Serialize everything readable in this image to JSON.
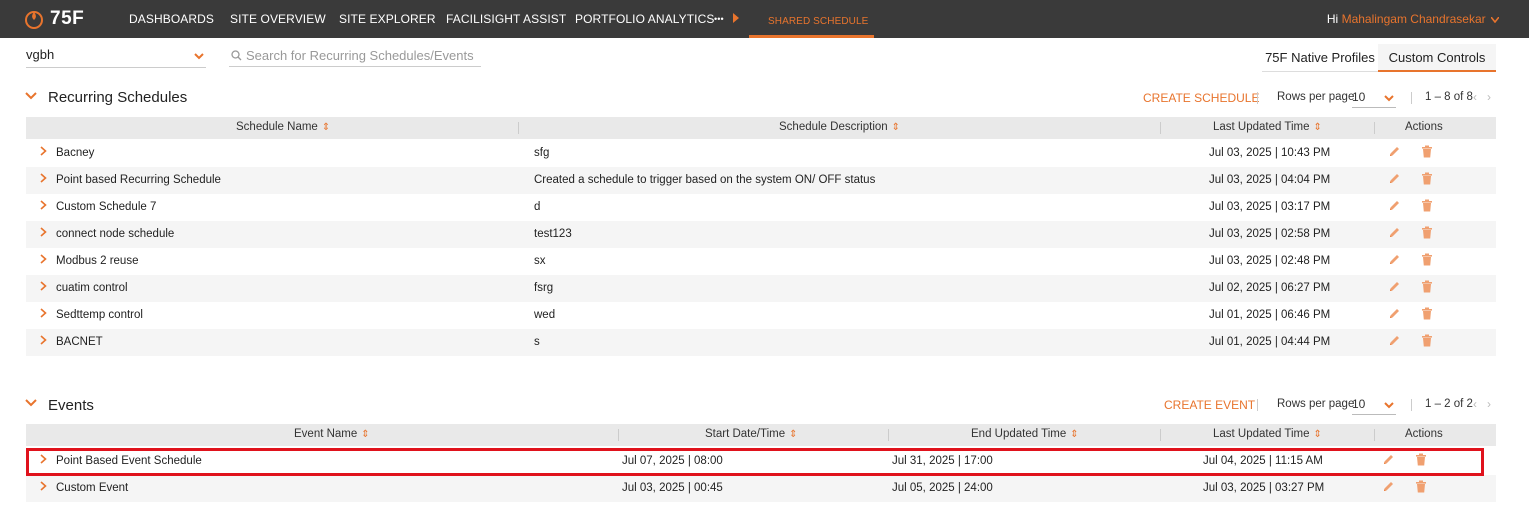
{
  "topbar": {
    "logo_text": "75F",
    "nav": [
      "DASHBOARDS",
      "SITE OVERVIEW",
      "SITE EXPLORER",
      "FACILISIGHT ASSIST",
      "PORTFOLIO ANALYTICS"
    ],
    "more": "•••",
    "active_tab": "SHARED SCHEDULE",
    "greeting": "Hi",
    "user_name": "Mahalingam Chandrasekar"
  },
  "filters": {
    "site": "vgbh",
    "search_placeholder": "Search for Recurring Schedules/Events"
  },
  "toggle": {
    "native": "75F Native Profiles",
    "custom": "Custom Controls"
  },
  "recurring": {
    "title": "Recurring Schedules",
    "create": "CREATE SCHEDULE",
    "rows_per_page_label": "Rows per page",
    "rows_per_page": "10",
    "range": "1 – 8 of 8",
    "columns": [
      "Schedule Name",
      "Schedule Description",
      "Last Updated Time",
      "Actions"
    ],
    "rows": [
      {
        "name": "Bacney",
        "desc": "sfg",
        "updated": "Jul 03, 2025 | 10:43 PM"
      },
      {
        "name": "Point based Recurring Schedule",
        "desc": "Created a schedule to trigger based on the system ON/ OFF status",
        "updated": "Jul 03, 2025 | 04:04 PM"
      },
      {
        "name": "Custom Schedule 7",
        "desc": "d",
        "updated": "Jul 03, 2025 | 03:17 PM"
      },
      {
        "name": "connect node schedule",
        "desc": "test123",
        "updated": "Jul 03, 2025 | 02:58 PM"
      },
      {
        "name": "Modbus 2 reuse",
        "desc": "sx",
        "updated": "Jul 03, 2025 | 02:48 PM"
      },
      {
        "name": "cuatim control",
        "desc": "fsrg",
        "updated": "Jul 02, 2025 | 06:27 PM"
      },
      {
        "name": "Sedttemp control",
        "desc": "wed",
        "updated": "Jul 01, 2025 | 06:46 PM"
      },
      {
        "name": "BACNET",
        "desc": "s",
        "updated": "Jul 01, 2025 | 04:44 PM"
      }
    ]
  },
  "events": {
    "title": "Events",
    "create": "CREATE EVENT",
    "rows_per_page_label": "Rows per page",
    "rows_per_page": "10",
    "range": "1 – 2 of 2",
    "columns": [
      "Event Name",
      "Start Date/Time",
      "End Updated Time",
      "Last Updated Time",
      "Actions"
    ],
    "rows": [
      {
        "name": "Point Based Event Schedule",
        "start": "Jul 07, 2025 | 08:00",
        "end": "Jul 31, 2025 | 17:00",
        "updated": "Jul 04, 2025 | 11:15 AM"
      },
      {
        "name": "Custom Event",
        "start": "Jul 03, 2025 | 00:45",
        "end": "Jul 05, 2025 | 24:00",
        "updated": "Jul 03, 2025 | 03:27 PM"
      }
    ]
  },
  "colors": {
    "accent": "#e8742d",
    "topbar": "#3a3a3a",
    "highlight": "#e0121c"
  },
  "icons": {
    "edit": "pencil-icon",
    "delete": "trash-icon",
    "expand": "chevron-right-icon"
  }
}
